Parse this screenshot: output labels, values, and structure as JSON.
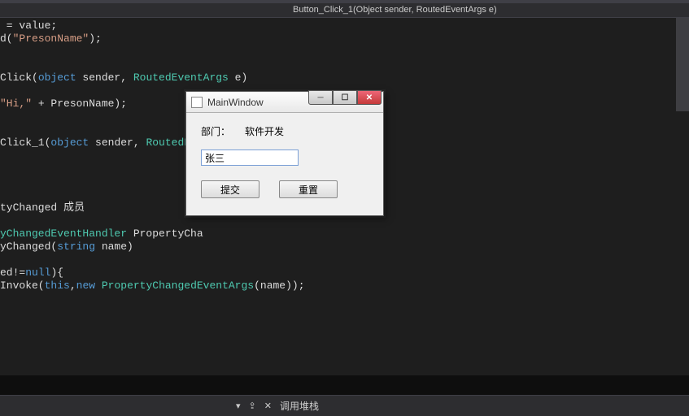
{
  "breadcrumb": {
    "text": "Button_Click_1(Object sender, RoutedEventArgs e)"
  },
  "code": {
    "lines": [
      {
        "segments": [
          {
            "text": " = ",
            "cls": "c-default"
          },
          {
            "text": "value",
            "cls": "c-default"
          },
          {
            "text": ";",
            "cls": "c-default"
          }
        ]
      },
      {
        "segments": [
          {
            "text": "d(",
            "cls": "c-default"
          },
          {
            "text": "\"PresonName\"",
            "cls": "c-string"
          },
          {
            "text": ");",
            "cls": "c-default"
          }
        ]
      },
      {
        "segments": []
      },
      {
        "segments": []
      },
      {
        "segments": [
          {
            "text": "Click(",
            "cls": "c-default"
          },
          {
            "text": "object",
            "cls": "c-keyword"
          },
          {
            "text": " sender, ",
            "cls": "c-default"
          },
          {
            "text": "RoutedEventArgs",
            "cls": "c-type"
          },
          {
            "text": " e)",
            "cls": "c-default"
          }
        ]
      },
      {
        "segments": []
      },
      {
        "segments": [
          {
            "text": "\"Hi,\"",
            "cls": "c-string"
          },
          {
            "text": " + PresonName);",
            "cls": "c-default"
          }
        ]
      },
      {
        "segments": []
      },
      {
        "segments": []
      },
      {
        "segments": [
          {
            "text": "Click_1(",
            "cls": "c-default"
          },
          {
            "text": "object",
            "cls": "c-keyword"
          },
          {
            "text": " sender, ",
            "cls": "c-default"
          },
          {
            "text": "RoutedEven",
            "cls": "c-type"
          }
        ]
      },
      {
        "segments": []
      },
      {
        "segments": []
      },
      {
        "segments": []
      },
      {
        "segments": []
      },
      {
        "segments": [
          {
            "text": "tyChanged 成员",
            "cls": "c-default"
          }
        ]
      },
      {
        "segments": []
      },
      {
        "segments": [
          {
            "text": "yChangedEventHandler",
            "cls": "c-type"
          },
          {
            "text": " PropertyCha",
            "cls": "c-default"
          }
        ]
      },
      {
        "segments": [
          {
            "text": "yChanged(",
            "cls": "c-default"
          },
          {
            "text": "string",
            "cls": "c-keyword"
          },
          {
            "text": " name)",
            "cls": "c-default"
          }
        ]
      },
      {
        "segments": []
      },
      {
        "segments": [
          {
            "text": "ed!=",
            "cls": "c-default"
          },
          {
            "text": "null",
            "cls": "c-keyword"
          },
          {
            "text": "){",
            "cls": "c-default"
          }
        ]
      },
      {
        "segments": [
          {
            "text": "Invoke(",
            "cls": "c-default"
          },
          {
            "text": "this",
            "cls": "c-keyword"
          },
          {
            "text": ",",
            "cls": "c-default"
          },
          {
            "text": "new",
            "cls": "c-keyword"
          },
          {
            "text": " ",
            "cls": "c-default"
          },
          {
            "text": "PropertyChangedEventArgs",
            "cls": "c-type"
          },
          {
            "text": "(name));",
            "cls": "c-default"
          }
        ]
      }
    ]
  },
  "dialog": {
    "title": "MainWindow",
    "dept_label": "部门：",
    "dept_value": "软件开发",
    "name_value": "张三",
    "submit_label": "提交",
    "reset_label": "重置"
  },
  "bottom": {
    "callstack": "调用堆栈"
  }
}
